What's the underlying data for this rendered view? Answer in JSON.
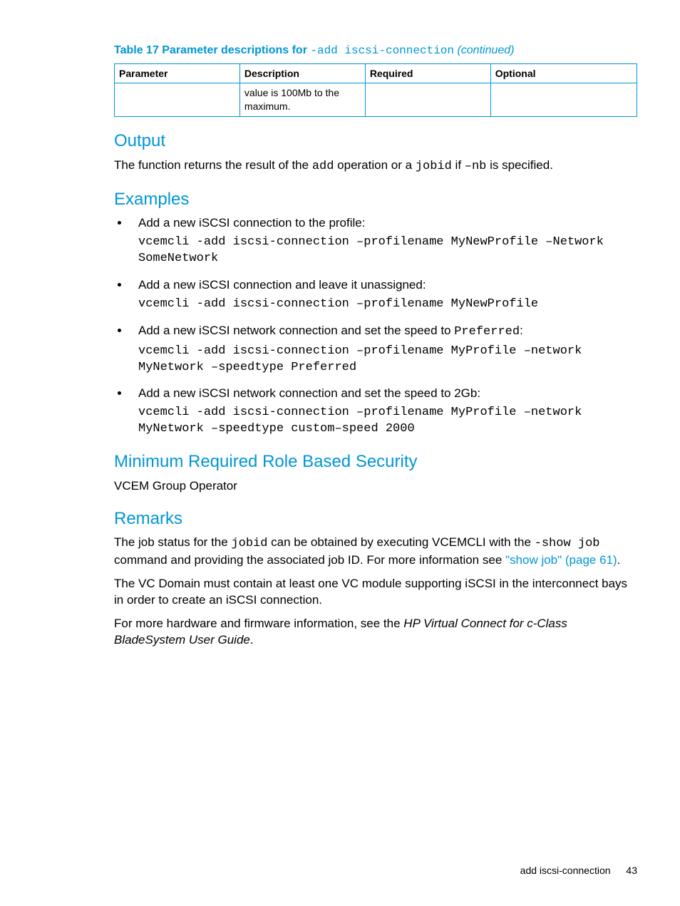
{
  "table": {
    "title_prefix": "Table 17 Parameter descriptions for ",
    "title_code": "-add iscsi-connection",
    "title_suffix": " (continued)",
    "headers": [
      "Parameter",
      "Description",
      "Required",
      "Optional"
    ],
    "row": {
      "parameter": "",
      "description": "value is 100Mb to the maximum.",
      "required": "",
      "optional": ""
    }
  },
  "sections": {
    "output": {
      "heading": "Output",
      "text_parts": {
        "p1a": "The function returns the result of the ",
        "code1": "add",
        "p1b": " operation or a ",
        "code2": "jobid",
        "p1c": " if ",
        "code3": "–nb",
        "p1d": " is specified."
      }
    },
    "examples": {
      "heading": "Examples",
      "items": [
        {
          "desc": "Add a new iSCSI connection to the profile:",
          "code": "vcemcli -add iscsi-connection –profilename MyNewProfile –Network SomeNetwork"
        },
        {
          "desc": "Add a new iSCSI connection and leave it unassigned:",
          "code": "vcemcli -add iscsi-connection –profilename MyNewProfile"
        },
        {
          "desc_pre": "Add a new iSCSI network connection and set the speed to ",
          "desc_code": "Preferred",
          "desc_post": ":",
          "code": "vcemcli -add iscsi-connection –profilename MyProfile –network MyNetwork –speedtype Preferred"
        },
        {
          "desc": "Add a new iSCSI network connection and set the speed to 2Gb:",
          "code": "vcemcli -add iscsi-connection –profilename MyProfile –network MyNetwork –speedtype custom–speed 2000"
        }
      ]
    },
    "security": {
      "heading": "Minimum Required Role Based Security",
      "text": "VCEM Group Operator"
    },
    "remarks": {
      "heading": "Remarks",
      "p1": {
        "a": "The job status for the ",
        "code1": "jobid",
        "b": " can be obtained by executing VCEMCLI with the ",
        "code2": "-show job",
        "c": " command and providing the associated job ID. For more information see ",
        "link": "\"show job\" (page 61)",
        "d": "."
      },
      "p2": "The VC Domain must contain at least one VC module supporting iSCSI in the interconnect bays in order to create an iSCSI connection.",
      "p3": {
        "a": "For more hardware and firmware information, see the ",
        "i": "HP Virtual Connect for c-Class BladeSystem User Guide",
        "b": "."
      }
    }
  },
  "footer": {
    "label": "add iscsi-connection",
    "page": "43"
  }
}
